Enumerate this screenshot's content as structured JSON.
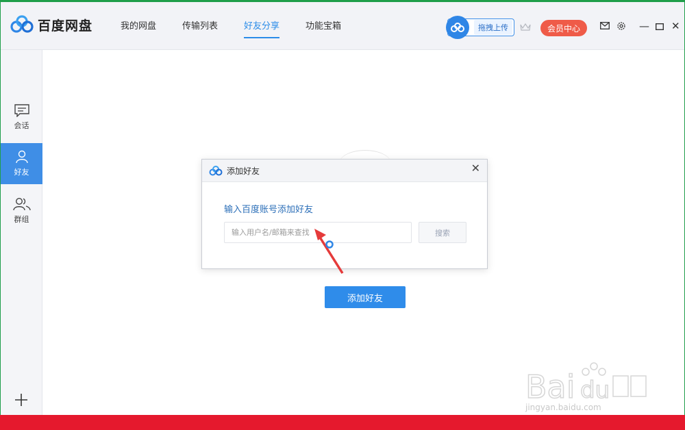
{
  "app": {
    "name": "百度网盘"
  },
  "nav": {
    "tabs": [
      {
        "label": "我的网盘",
        "active": false
      },
      {
        "label": "传输列表",
        "active": false
      },
      {
        "label": "好友分享",
        "active": true
      },
      {
        "label": "功能宝箱",
        "active": false
      }
    ]
  },
  "toolbar": {
    "upload_label": "拖拽上传",
    "vip_label": "会员中心"
  },
  "sidebar": {
    "items": [
      {
        "label": "会话",
        "icon": "chat-icon",
        "active": false
      },
      {
        "label": "好友",
        "icon": "user-icon",
        "active": true
      },
      {
        "label": "群组",
        "icon": "group-icon",
        "active": false
      }
    ]
  },
  "main": {
    "add_friend_label": "添加好友"
  },
  "dialog": {
    "title": "添加好友",
    "label": "输入百度账号添加好友",
    "input_placeholder": "输入用户名/邮箱来查找",
    "search_label": "搜索"
  },
  "watermark": {
    "url": "jingyan.baidu.com"
  },
  "colors": {
    "accent": "#2f8cea",
    "vip": "#ef5b48",
    "bottom_bar": "#e5192d",
    "window_border": "#1f9e4a"
  }
}
